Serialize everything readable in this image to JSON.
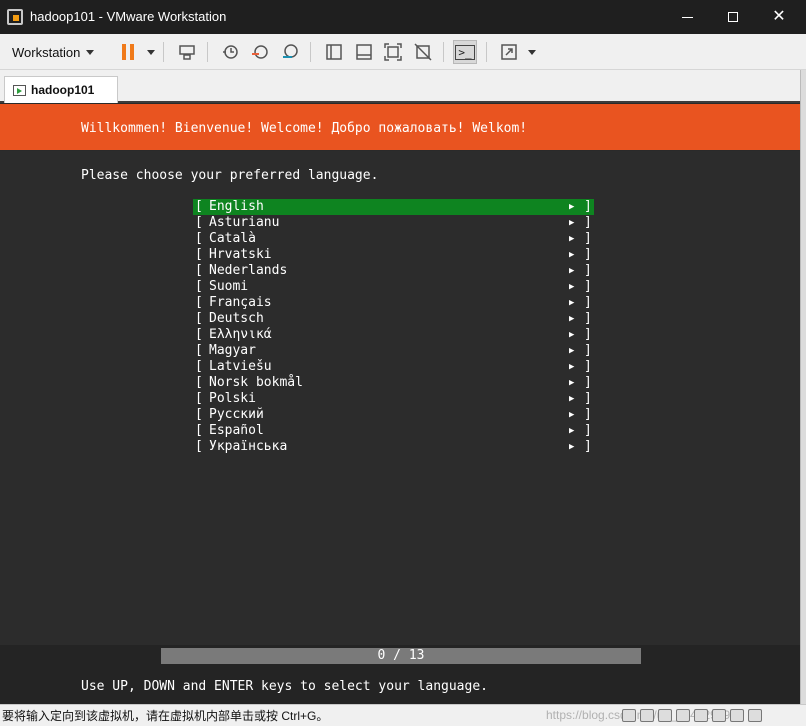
{
  "window": {
    "title": "hadoop101 - VMware Workstation",
    "minimize_icon": "minimize-icon",
    "maximize_icon": "maximize-icon",
    "close_glyph": "✕"
  },
  "toolbar": {
    "workstation_label": "Workstation",
    "pause_color": "#f07a1a",
    "icons": [
      "send-ctrl-alt-del-icon",
      "snapshot-icon",
      "revert-snapshot-icon",
      "snapshot-manager-icon",
      "library-view-icon",
      "thumbnail-view-icon",
      "fit-guest-icon",
      "unity-icon",
      "console-view-icon",
      "full-screen-icon"
    ]
  },
  "tabs": [
    {
      "label": "hadoop101",
      "active": true
    }
  ],
  "installer": {
    "banner": "Willkommen! Bienvenue! Welcome! Добро пожаловать! Welkom!",
    "banner_color": "#e95420",
    "prompt": "Please choose your preferred language.",
    "selected_color": "#0e8420",
    "languages": [
      {
        "name": "English",
        "selected": true
      },
      {
        "name": "Asturianu"
      },
      {
        "name": "Català"
      },
      {
        "name": "Hrvatski"
      },
      {
        "name": "Nederlands"
      },
      {
        "name": "Suomi"
      },
      {
        "name": "Français"
      },
      {
        "name": "Deutsch"
      },
      {
        "name": "Ελληνικά"
      },
      {
        "name": "Magyar"
      },
      {
        "name": "Latviešu"
      },
      {
        "name": "Norsk bokmål"
      },
      {
        "name": "Polski"
      },
      {
        "name": "Русский"
      },
      {
        "name": "Español"
      },
      {
        "name": "Українська"
      }
    ],
    "progress_text": "0 / 13",
    "progress_fraction": 0,
    "help": "Use UP, DOWN and ENTER keys to select your language."
  },
  "statusbar": {
    "message": "要将输入定向到该虚拟机，请在虚拟机内部单击或按 Ctrl+G。",
    "watermark": "https://blog.csdn.net/u0_42402959"
  }
}
